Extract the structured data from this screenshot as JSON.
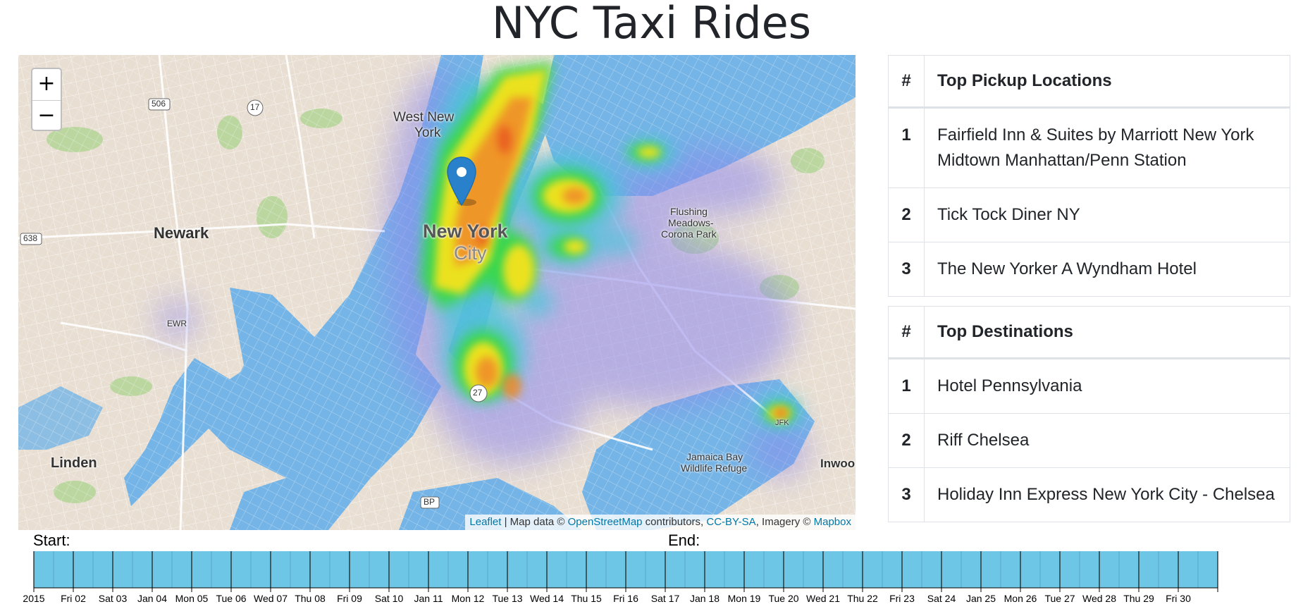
{
  "title": "NYC Taxi Rides",
  "map": {
    "zoom_in": "+",
    "zoom_out": "−",
    "labels": {
      "west_new_york_1": "West New",
      "west_new_york_2": "York",
      "newark": "Newark",
      "new_york_1": "New York",
      "new_york_2": "City",
      "flushing_1": "Flushing",
      "flushing_2": "Meadows-",
      "flushing_3": "Corona Park",
      "linden": "Linden",
      "jamaica_1": "Jamaica Bay",
      "jamaica_2": "Wildlife Refuge",
      "inwood": "Inwoo",
      "ewr": "EWR",
      "jfk": "JFK",
      "r506": "506",
      "r17": "17",
      "r638": "638",
      "r27": "27",
      "bp": "BP"
    },
    "attribution": {
      "leaflet": "Leaflet",
      "t1": " | Map data © ",
      "osm": "OpenStreetMap",
      "t2": " contributors, ",
      "ccbysa": "CC-BY-SA",
      "t3": ", Imagery © ",
      "mapbox": "Mapbox"
    }
  },
  "pickup_table": {
    "col_num": "#",
    "col_name": "Top Pickup Locations",
    "rows": [
      {
        "rank": "1",
        "name": "Fairfield Inn & Suites by Marriott New York Midtown Manhattan/Penn Station"
      },
      {
        "rank": "2",
        "name": "Tick Tock Diner NY"
      },
      {
        "rank": "3",
        "name": "The New Yorker A Wyndham Hotel"
      }
    ]
  },
  "dest_table": {
    "col_num": "#",
    "col_name": "Top Destinations",
    "rows": [
      {
        "rank": "1",
        "name": "Hotel Pennsylvania"
      },
      {
        "rank": "2",
        "name": "Riff Chelsea"
      },
      {
        "rank": "3",
        "name": "Holiday Inn Express New York City - Chelsea"
      }
    ]
  },
  "timeline": {
    "start_label": "Start:",
    "end_label": "End:",
    "ticks": [
      "2015",
      "Fri 02",
      "Sat 03",
      "Jan 04",
      "Mon 05",
      "Tue 06",
      "Wed 07",
      "Thu 08",
      "Fri 09",
      "Sat 10",
      "Jan 11",
      "Mon 12",
      "Tue 13",
      "Wed 14",
      "Thu 15",
      "Fri 16",
      "Sat 17",
      "Jan 18",
      "Mon 19",
      "Tue 20",
      "Wed 21",
      "Thu 22",
      "Fri 23",
      "Sat 24",
      "Jan 25",
      "Mon 26",
      "Tue 27",
      "Wed 28",
      "Thu 29",
      "Fri 30"
    ],
    "bar_color": "#6ec6e6"
  }
}
